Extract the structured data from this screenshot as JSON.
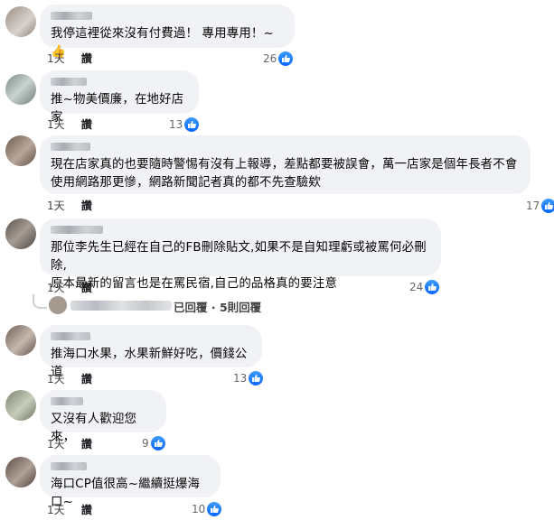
{
  "comments": [
    {
      "text": "我停這裡從來沒有付費過！ 專用專用！~👍",
      "time": "1天",
      "like": "讚",
      "reactions": "26"
    },
    {
      "text": "推~物美價廉，在地好店家",
      "time": "1天",
      "like": "讚",
      "reactions": "13"
    },
    {
      "text": "現在店家真的也要隨時警惕有沒有上報導，差點都要被誤會，萬一店家是個年長者不會\n使用網路那更慘，網路新聞記者真的都不先查驗欸",
      "time": "1天",
      "like": "讚",
      "reactions": "17"
    },
    {
      "text": "那位李先生已經在自己的FB刪除貼文,如果不是自知理虧或被罵何必刪除,\n原本最新的留言也是在罵民宿,自己的品格真的要注意",
      "time": "1天",
      "like": "讚",
      "reactions": "24"
    },
    {
      "text": "推海口水果，水果新鮮好吃，價錢公道",
      "time": "1天",
      "like": "讚",
      "reactions": "13"
    },
    {
      "text": "又沒有人歡迎您來，",
      "time": "1天",
      "like": "讚",
      "reactions": "9"
    },
    {
      "text": "海口CP值很高~繼續挺爆海口~",
      "time": "1天",
      "like": "讚",
      "reactions": "10"
    }
  ],
  "reply_summary": "已回覆 · 5則回覆",
  "colors": {
    "bubble": "#f0f2f5",
    "like_blue": "#0866ff",
    "meta_text": "#65676b"
  },
  "icons": {
    "reaction": "thumbs-up-icon"
  }
}
